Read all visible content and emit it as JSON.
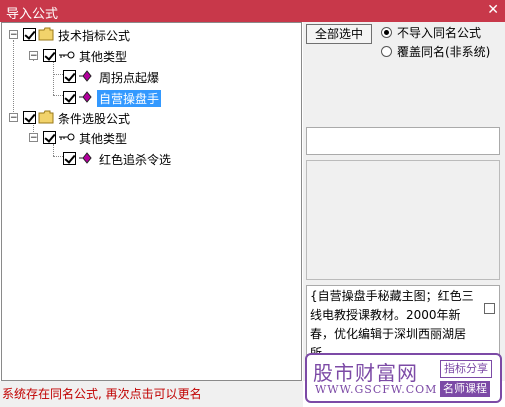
{
  "window": {
    "title": "导入公式",
    "close_label": "✕"
  },
  "tree": {
    "group1": {
      "label": "技术指标公式",
      "subgroup": {
        "label": "其他类型",
        "items": [
          {
            "label": "周拐点起爆"
          },
          {
            "label": "自营操盘手"
          }
        ]
      }
    },
    "group2": {
      "label": "条件选股公式",
      "subgroup": {
        "label": "其他类型",
        "items": [
          {
            "label": "红色追杀令选"
          }
        ]
      }
    }
  },
  "controls": {
    "select_all": "全部选中",
    "radio1": "不导入同名公式",
    "radio2": "覆盖同名(非系统)"
  },
  "description": "{自营操盘手秘藏主图；红色三线电教授课教材。2000年新春，优化编辑于深圳西丽湖居所。",
  "status": "系统存在同名公式, 再次点击可以更名",
  "watermark": {
    "title": "股市财富网",
    "url": "WWW.GSCFW.COM",
    "tag1": "指标分享",
    "tag2": "名师课程"
  },
  "colors": {
    "titlebar": "#c8384a",
    "status_text": "#c00000",
    "selection": "#3399ff",
    "watermark": "#7c4aa6",
    "folder": "#f2d36b",
    "formula_icon": "#b2009c"
  }
}
